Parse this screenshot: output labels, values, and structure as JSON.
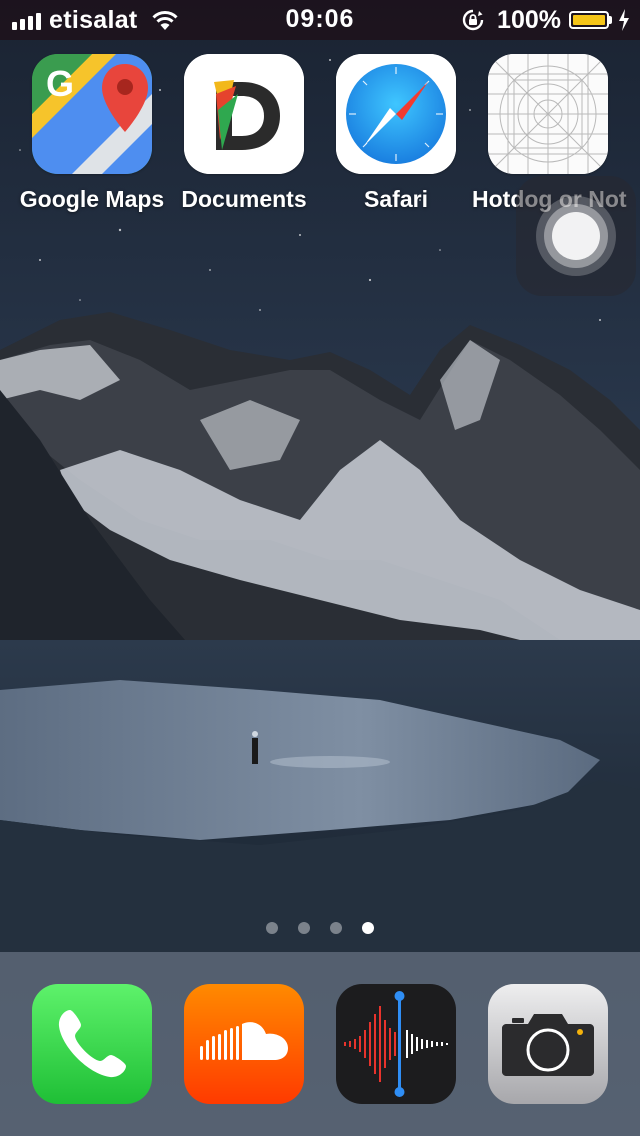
{
  "status_bar": {
    "carrier": "etisalat",
    "time": "09:06",
    "battery_percent": "100%",
    "battery_level": 1.0,
    "battery_color": "#F5C518",
    "icons": [
      "signal-icon",
      "wifi-icon",
      "rotation-lock-icon",
      "battery-icon",
      "charging-icon"
    ]
  },
  "home_screen": {
    "apps": [
      {
        "label": "Google Maps",
        "icon": "google-maps-icon"
      },
      {
        "label": "Documents",
        "icon": "documents-icon"
      },
      {
        "label": "Safari",
        "icon": "safari-icon"
      },
      {
        "label": "Hotdog or Not",
        "icon": "hotdog-or-not-icon"
      }
    ],
    "pages": {
      "count": 4,
      "active": 4
    }
  },
  "dock": {
    "apps": [
      {
        "name": "Phone",
        "icon": "phone-icon"
      },
      {
        "name": "SoundCloud",
        "icon": "soundcloud-icon"
      },
      {
        "name": "Voice Memos",
        "icon": "voice-memos-icon"
      },
      {
        "name": "Camera",
        "icon": "camera-icon"
      }
    ]
  },
  "colors": {
    "status_bar_bg": "#1e1018",
    "phone_green": "#34C759",
    "soundcloud_orange": "#FF5500",
    "voice_memos_bg": "#1c1c1e",
    "safari_blue": "#1E9BF0"
  }
}
